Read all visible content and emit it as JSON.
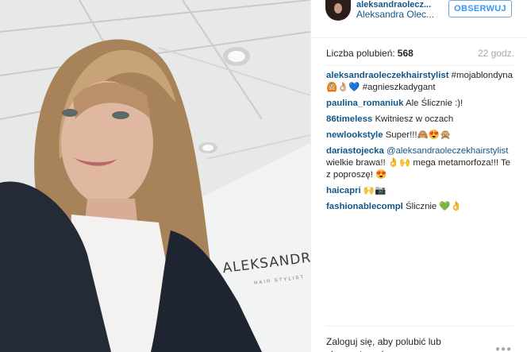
{
  "photo": {
    "alt": "Selfie photo",
    "wall_sign": "ALEKSANDRA·OLE",
    "wall_sub": "HAIR STYLIST"
  },
  "header": {
    "username": "aleksandraolecz...",
    "display_name": "Aleksandra Olec...",
    "follow_label": "OBSERWUJ"
  },
  "stats": {
    "likes_label": "Liczba polubień:",
    "likes_count": "568",
    "time": "22 godz."
  },
  "comments": [
    {
      "user": "aleksandraoleczekhairstylist",
      "mention": "",
      "text": "#mojablondyna🙆🏼👌🏼💙 #agnieszkadygant"
    },
    {
      "user": "paulina_romaniuk",
      "mention": "",
      "text": "Ale Ślicznie :)!"
    },
    {
      "user": "86timeless",
      "mention": "",
      "text": "Kwitniesz w oczach"
    },
    {
      "user": "newlookstyle",
      "mention": "",
      "text": "Super!!!🙈😍🙊"
    },
    {
      "user": "dariastojecka",
      "mention": "@aleksandraoleczekhairstylist",
      "text": "wielkie brawa!! 👌🙌 mega metamorfoza!!! Tez poproszę! 😍"
    },
    {
      "user": "haicapri",
      "mention": "",
      "text": "🙌📷"
    },
    {
      "user": "fashionablecompl",
      "mention": "",
      "text": "Ślicznie 💚👌"
    }
  ],
  "footer": {
    "login_text": "Zaloguj się, aby polubić lub skomentować.",
    "more_icon": "more-dots-icon"
  }
}
